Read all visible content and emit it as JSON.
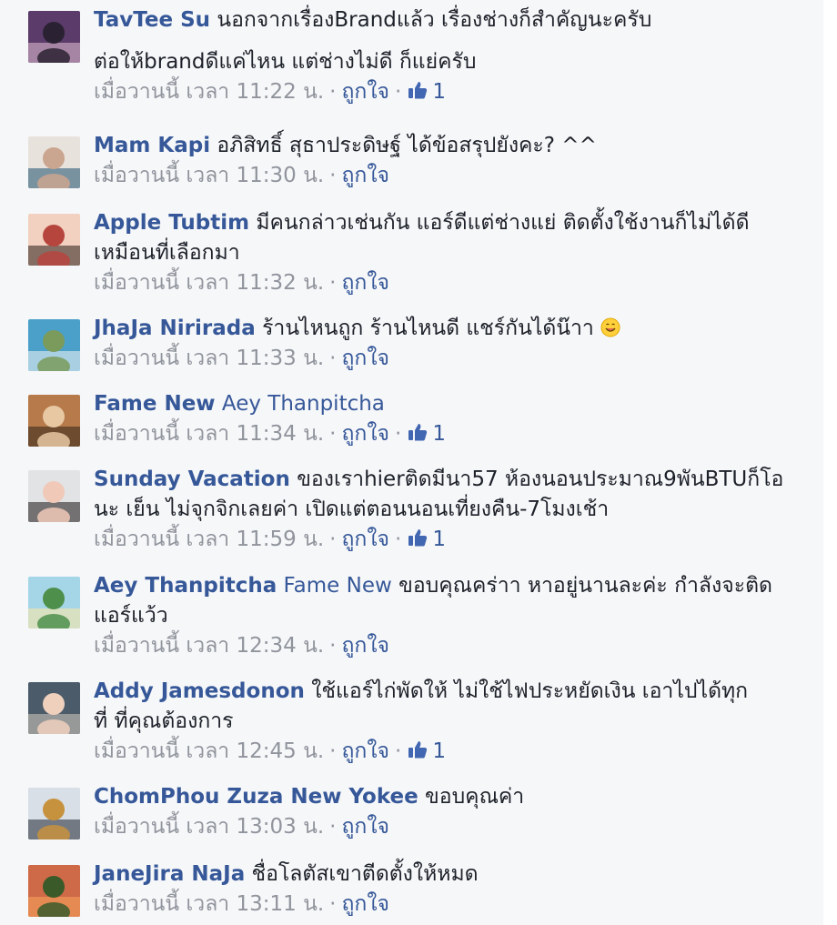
{
  "comments": [
    {
      "author": "TavTee Su",
      "lines": [
        "นอกจากเรื่องBrandแล้ว เรื่องช่างก็สำคัญนะครับ",
        "",
        "ต่อให้brandดีแค่ไหน แต่ช่างไม่ดี ก็แย่ครับ"
      ],
      "time": "เมื่อวานนี้ เวลา 11:22 น.",
      "like_label": "ถูกใจ",
      "likes": "1"
    },
    {
      "author": "Mam Kapi",
      "lines": [
        "อภิสิทธิ์ สุธาประดิษฐ์ ได้ข้อสรุปยังคะ? ^^"
      ],
      "time": "เมื่อวานนี้ เวลา 11:30 น.",
      "like_label": "ถูกใจ"
    },
    {
      "author": "Apple Tubtim",
      "lines": [
        "มีคนกล่าวเช่นกัน แอร์ดีแต่ช่างแย่ ติดตั้งใช้งานก็ไม่ได้ดี",
        "เหมือนที่เลือกมา"
      ],
      "time": "เมื่อวานนี้ เวลา 11:32 น.",
      "like_label": "ถูกใจ"
    },
    {
      "author": "JhaJa Nirirada",
      "lines": [
        "ร้านไหนถูก ร้านไหนดี แชร์กันได้น๊าา"
      ],
      "emoji": "smile-emoji",
      "time": "เมื่อวานนี้ เวลา 11:33 น.",
      "like_label": "ถูกใจ"
    },
    {
      "author": "Fame New",
      "tag": "Aey Thanpitcha",
      "lines": [
        ""
      ],
      "time": "เมื่อวานนี้ เวลา 11:34 น.",
      "like_label": "ถูกใจ",
      "likes": "1"
    },
    {
      "author": "Sunday Vacation",
      "lines": [
        "ของเราhierติดมีนา57 ห้องนอนประมาณ9พันBTUก็โอ",
        "นะ เย็น ไม่จุกจิกเลยค่า เปิดแต่ตอนนอนเที่ยงคืน-7โมงเช้า"
      ],
      "time": "เมื่อวานนี้ เวลา 11:59 น.",
      "like_label": "ถูกใจ",
      "likes": "1"
    },
    {
      "author": "Aey Thanpitcha",
      "tag": "Fame New",
      "lines": [
        "ขอบคุณคร่าา หาอยู่นานละค่ะ กำลังจะติด",
        "แอร์แว้ว"
      ],
      "time": "เมื่อวานนี้ เวลา 12:34 น.",
      "like_label": "ถูกใจ"
    },
    {
      "author": "Addy Jamesdonon",
      "lines": [
        "ใช้แอร์ไก่พัดให้ ไม่ใช้ไฟประหยัดเงิน เอาไปได้ทุก",
        "ที่ ที่คุณต้องการ"
      ],
      "time": "เมื่อวานนี้ เวลา 12:45 น.",
      "like_label": "ถูกใจ",
      "likes": "1"
    },
    {
      "author": "ChomPhou Zuza New Yokee",
      "lines": [
        "ขอบคุณค่า"
      ],
      "time": "เมื่อวานนี้ เวลา 13:03 น.",
      "like_label": "ถูกใจ"
    },
    {
      "author": "JaneJira NaJa",
      "lines": [
        "ชื่อโลตัสเขาตีดตั้งให้หมด"
      ],
      "time": "เมื่อวานนี้ เวลา 13:11 น.",
      "like_label": "ถูกใจ"
    }
  ],
  "colors": {
    "author_link": "#365899",
    "text": "#1d2129",
    "meta": "#90949c",
    "background": "#f6f7f9"
  },
  "icons": {
    "like": "thumbs-up-icon",
    "avatar": "avatar-photo"
  }
}
